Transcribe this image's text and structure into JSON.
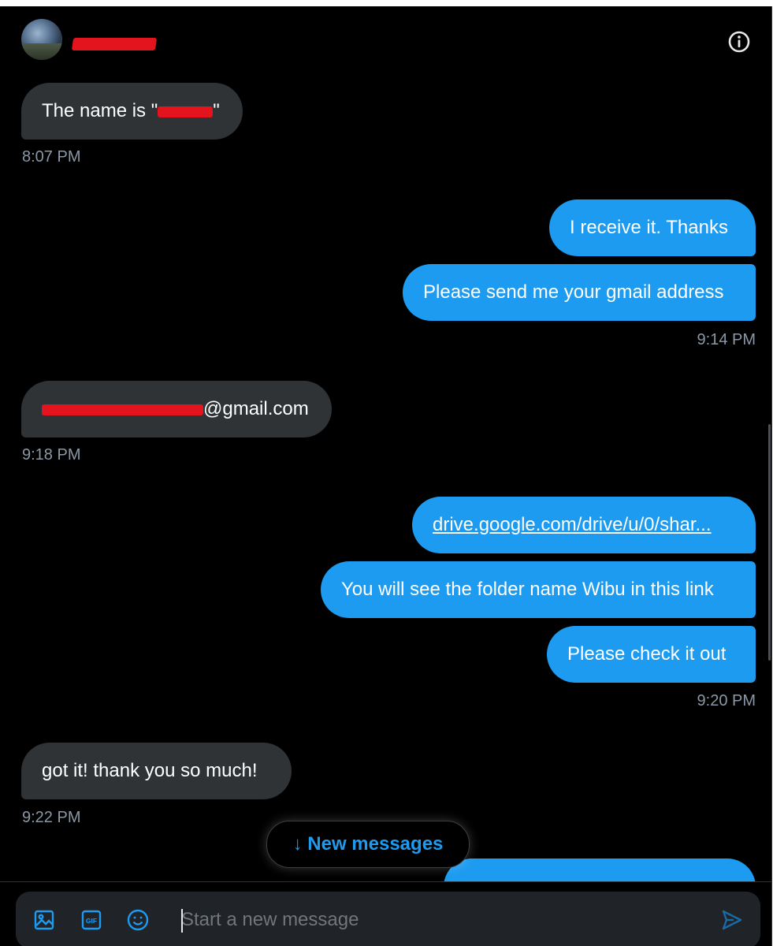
{
  "header": {
    "contact_name": "",
    "info_icon": "info-icon"
  },
  "colors": {
    "accent": "#1d9bf0",
    "incoming_bubble": "#2f3336",
    "background": "#000000",
    "timestamp": "#8b98a5"
  },
  "messages": [
    {
      "dir": "in",
      "text": "The name is \"",
      "suffix": "\""
    },
    {
      "time": "8:07 PM"
    },
    {
      "dir": "out",
      "text": "I receive it. Thanks"
    },
    {
      "dir": "out",
      "text": "Please send me your gmail address"
    },
    {
      "time": "9:14 PM"
    },
    {
      "dir": "in",
      "text": "@gmail.com"
    },
    {
      "time": "9:18 PM"
    },
    {
      "dir": "out",
      "text": "drive.google.com/drive/u/0/shar..."
    },
    {
      "dir": "out",
      "text": "You will see the folder name Wibu in this link"
    },
    {
      "dir": "out",
      "text": "Please check it out"
    },
    {
      "time": "9:20 PM"
    },
    {
      "dir": "in",
      "text": "got it! thank you so much!"
    },
    {
      "time": "9:22 PM"
    }
  ],
  "new_messages_button": {
    "arrow": "↓",
    "label": "New messages"
  },
  "composer": {
    "placeholder": "Start a new message",
    "icons": [
      "image-icon",
      "gif-icon",
      "emoji-icon",
      "send-icon"
    ],
    "gif_label": "GIF"
  }
}
